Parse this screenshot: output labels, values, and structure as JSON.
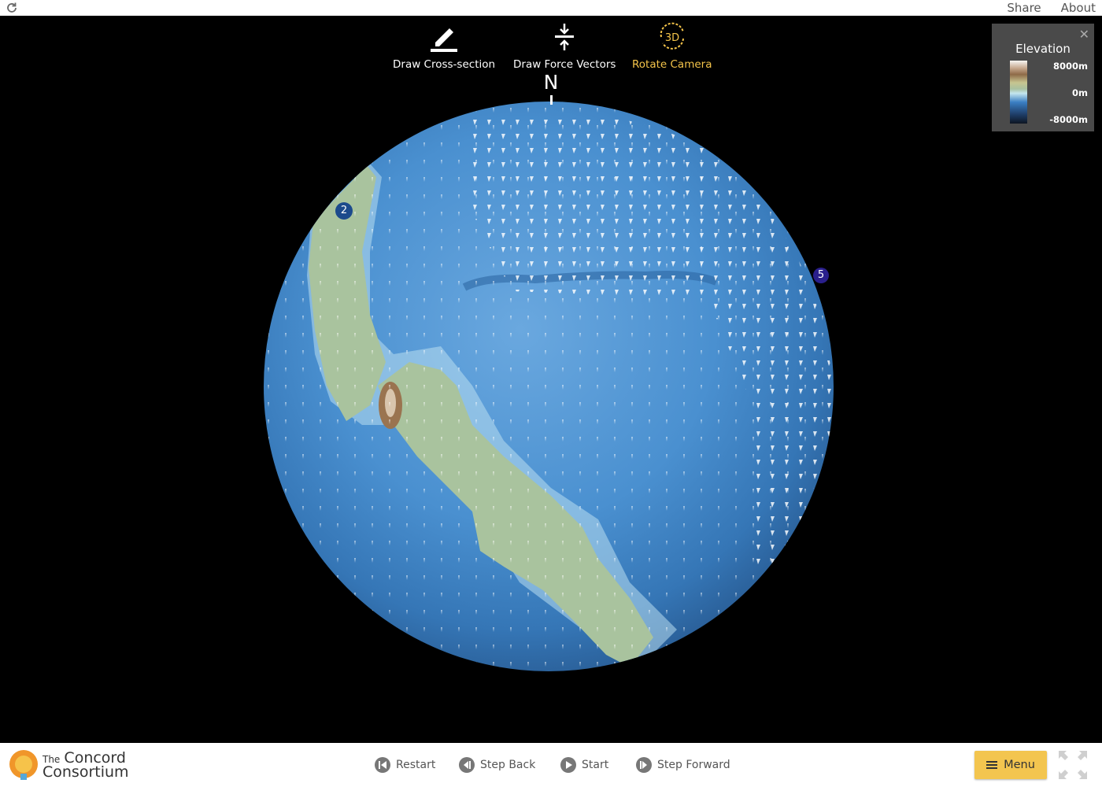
{
  "header": {
    "share": "Share",
    "about": "About"
  },
  "tools": [
    {
      "label": "Draw Cross-section",
      "icon": "pencil-icon",
      "active": false
    },
    {
      "label": "Draw Force Vectors",
      "icon": "force-vectors-icon",
      "active": false
    },
    {
      "label": "Rotate Camera",
      "icon": "rotate-3d-icon",
      "icon_text": "3D",
      "active": true
    }
  ],
  "compass": {
    "north": "N"
  },
  "legend": {
    "title": "Elevation",
    "ticks": [
      "8000m",
      "0m",
      "-8000m"
    ],
    "close_icon": "close-icon"
  },
  "markers": [
    {
      "label": "2",
      "color": "#1c4a8c"
    },
    {
      "label": "5",
      "color": "#2a1f8c"
    }
  ],
  "footer": {
    "logo_line1": "The",
    "logo_line1b": "Concord",
    "logo_line2": "Consortium",
    "controls": [
      {
        "label": "Restart",
        "icon": "restart-icon"
      },
      {
        "label": "Step Back",
        "icon": "step-back-icon"
      },
      {
        "label": "Start",
        "icon": "play-icon"
      },
      {
        "label": "Step Forward",
        "icon": "step-forward-icon"
      }
    ],
    "menu": "Menu"
  }
}
